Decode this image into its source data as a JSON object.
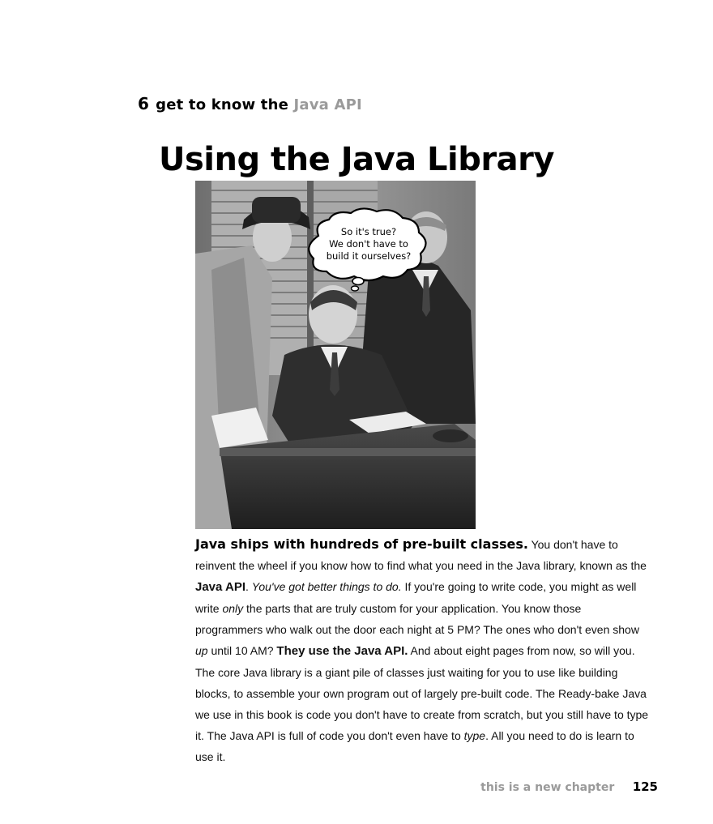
{
  "header": {
    "chapter_number": "6",
    "chapter_prefix": "get to know the ",
    "chapter_accent": "Java API"
  },
  "title": "Using the Java Library",
  "illustration": {
    "thought_bubble_lines": [
      "So it's true?",
      "We don't have to",
      "build it ourselves?"
    ]
  },
  "body": {
    "lead": "Java ships with hundreds of pre-built classes.",
    "t1": "  You don't have to reinvent the wheel if you know how to find what you need in the Java library, known as the ",
    "b1": "Java API",
    "t2": ".  ",
    "i1": "You've got better things to do.",
    "t3": " If you're going to write code, you might as well write ",
    "i2": "only",
    "t4": " the parts that are truly custom for your application. You know those programmers who walk out the door each night at 5 PM? The ones who don't even show ",
    "i3": "up",
    "t5": " until 10 AM? ",
    "b2": "They use the Java API.",
    "t6": " And about eight pages from now, so will you. The core Java library is a giant pile of classes just waiting for you to use like building blocks, to assemble your own program out of largely pre-built code. The Ready-bake Java we use in this book is code you don't have to create from scratch, but you still have to type it. The Java API is full of code you don't even have to ",
    "i4": "type",
    "t7": ". All you need to do is learn to use it."
  },
  "footer": {
    "note": "this is a new chapter",
    "page_number": "125"
  }
}
